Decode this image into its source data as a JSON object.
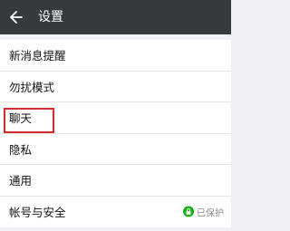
{
  "header": {
    "title": "设置",
    "back_icon": "arrow-left-icon"
  },
  "settings": {
    "items": [
      {
        "label": "新消息提醒"
      },
      {
        "label": "勿扰模式"
      },
      {
        "label": "聊天"
      },
      {
        "label": "隐私"
      },
      {
        "label": "通用"
      },
      {
        "label": "帐号与安全",
        "status": "已保护",
        "status_icon": "shield-lock-icon"
      }
    ]
  },
  "colors": {
    "header_bg": "#37393d",
    "highlight_border": "#d92b2b",
    "protect_green": "#1aad19"
  }
}
